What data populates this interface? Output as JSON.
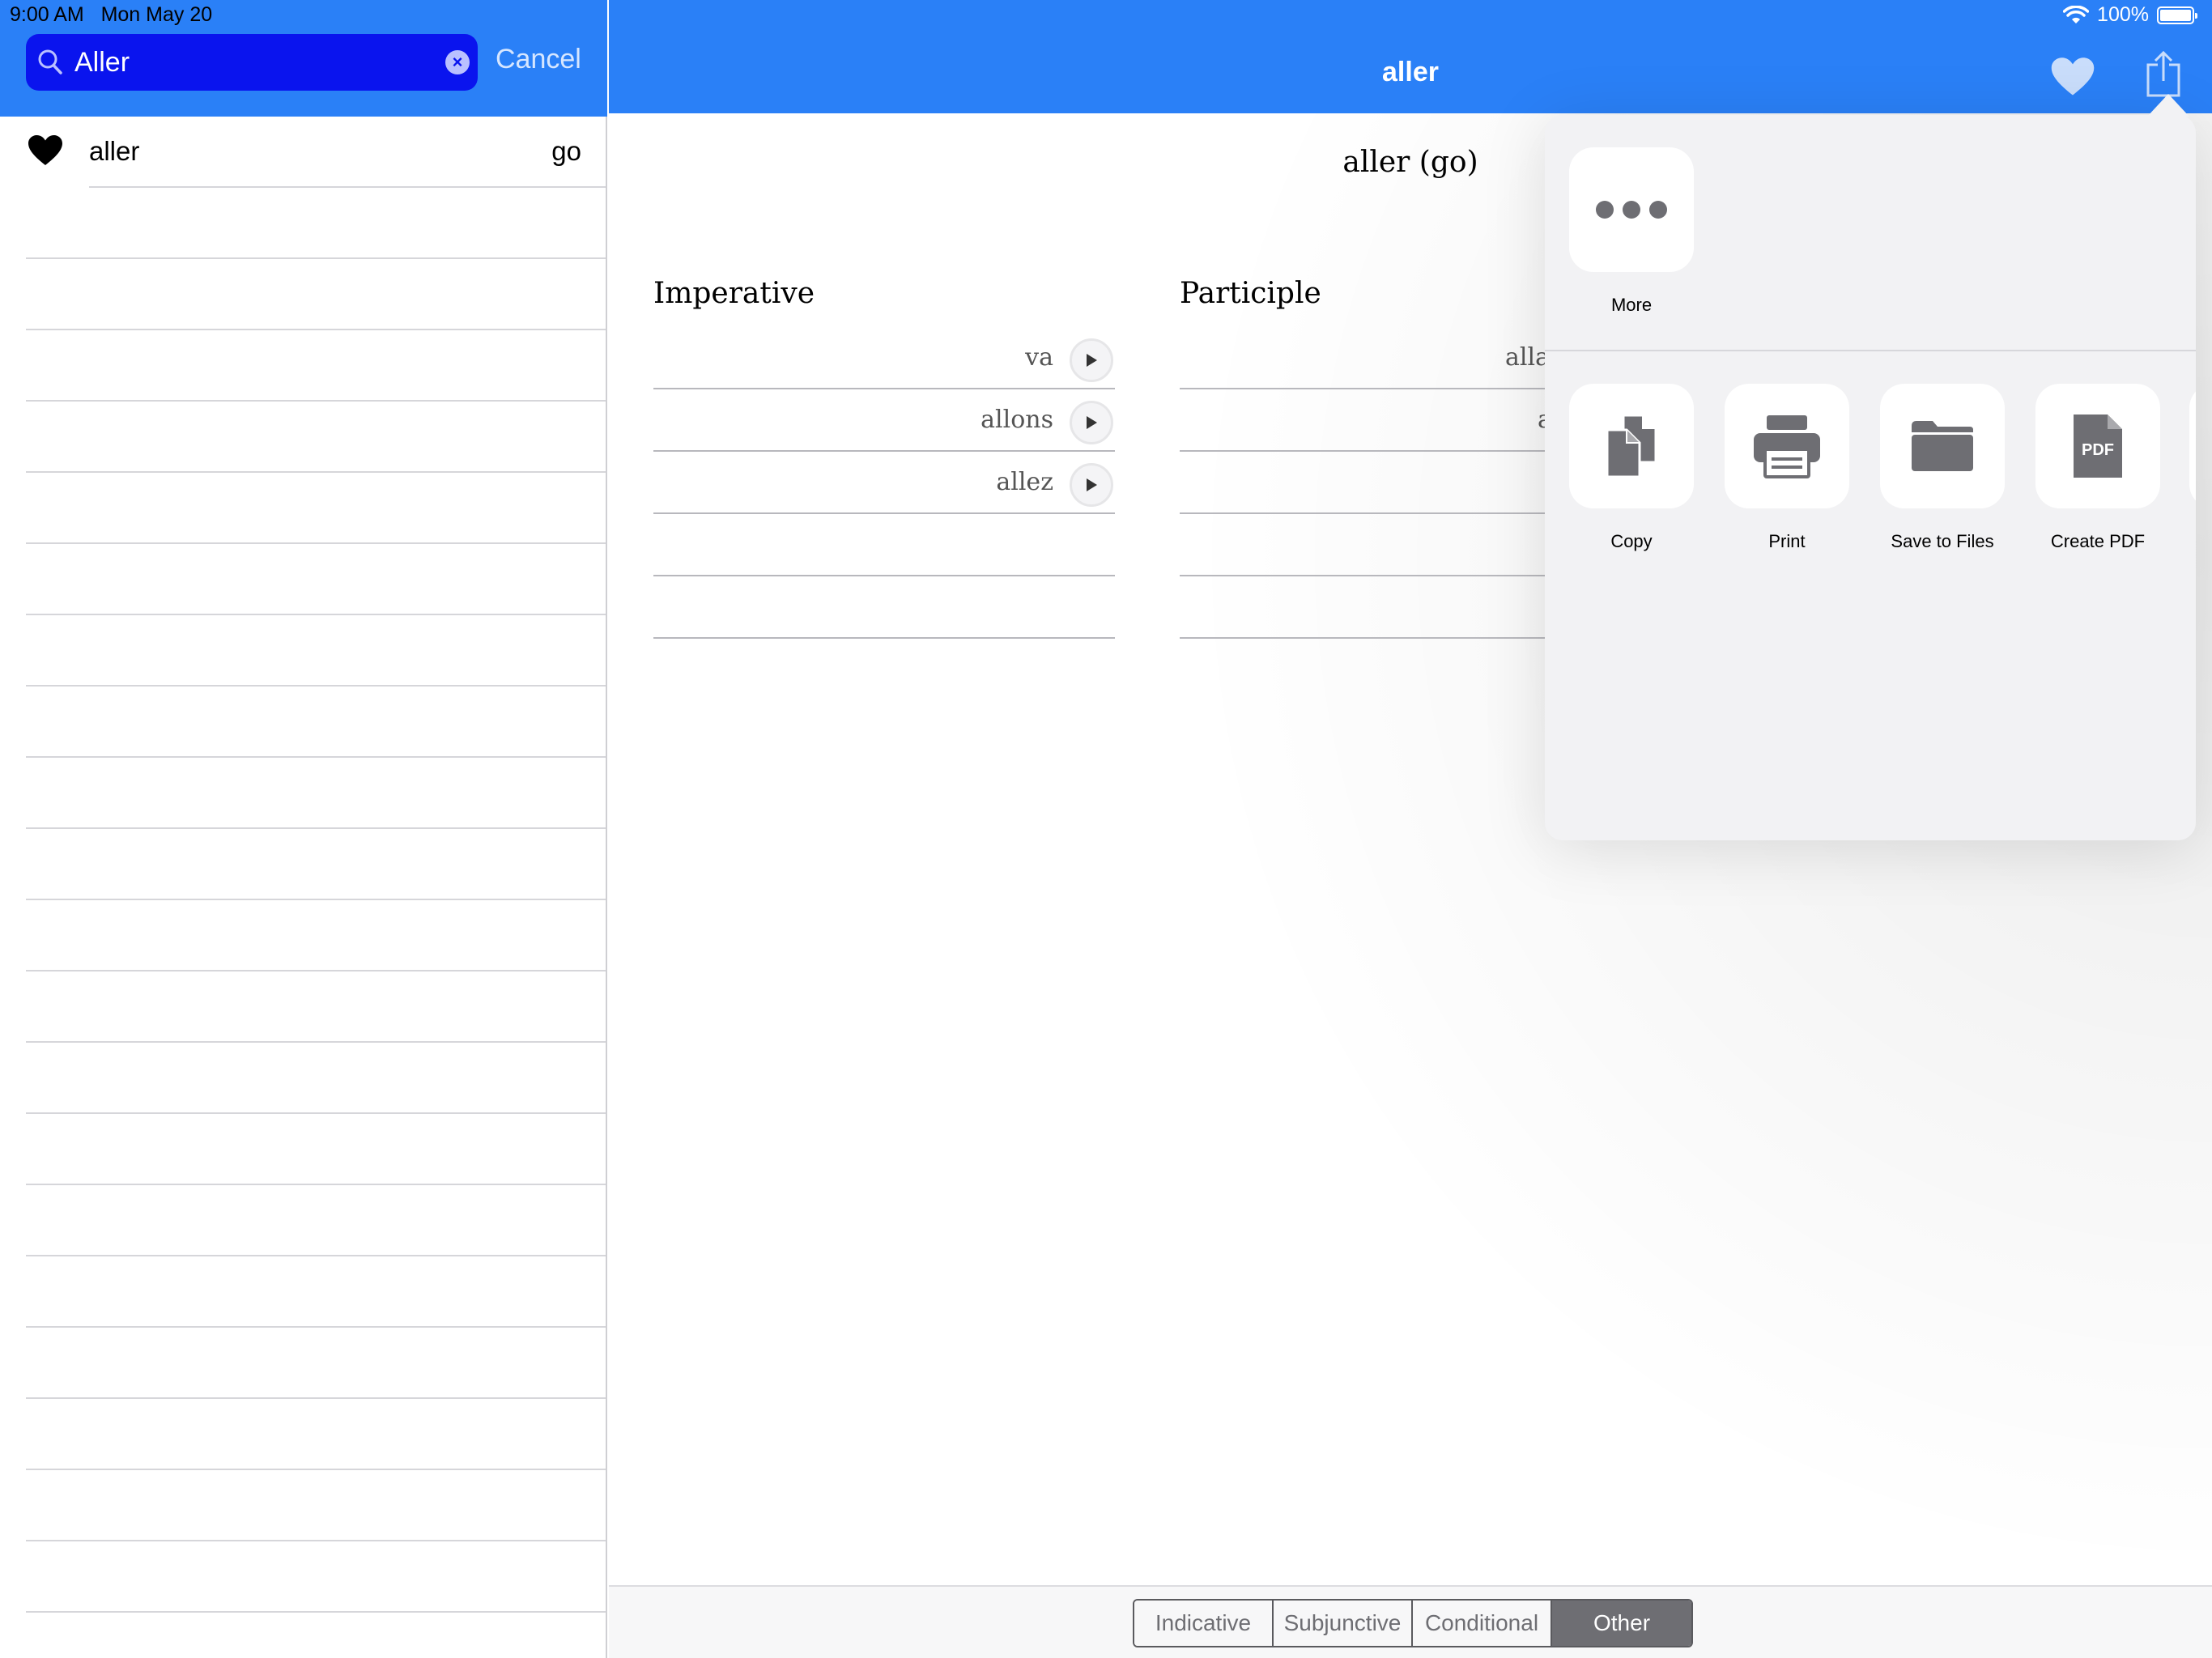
{
  "status_bar": {
    "time": "9:00 AM",
    "date": "Mon May 20",
    "battery_percent": "100%",
    "battery_level": 1.0
  },
  "search": {
    "value": "Aller",
    "placeholder": "Search",
    "cancel_label": "Cancel"
  },
  "results": [
    {
      "word": "aller",
      "translation": "go",
      "favorite": true
    }
  ],
  "main": {
    "title": "aller",
    "verb_heading": "aller (go)",
    "sections": [
      {
        "title": "Imperative",
        "forms": [
          "va",
          "allons",
          "allez"
        ],
        "empty_rows": 2
      },
      {
        "title": "Participle",
        "forms": [
          "alla",
          "a"
        ],
        "empty_rows": 3
      }
    ]
  },
  "tabs": [
    {
      "label": "Indicative",
      "active": false
    },
    {
      "label": "Subjunctive",
      "active": false
    },
    {
      "label": "Conditional",
      "active": false
    },
    {
      "label": "Other",
      "active": true
    }
  ],
  "share_sheet": {
    "top_actions": [
      {
        "label": "More",
        "icon": "more-icon"
      }
    ],
    "actions": [
      {
        "label": "Copy",
        "icon": "copy-icon"
      },
      {
        "label": "Print",
        "icon": "print-icon"
      },
      {
        "label": "Save to Files",
        "icon": "folder-icon"
      },
      {
        "label": "Create PDF",
        "icon": "pdf-icon",
        "icon_text": "PDF"
      }
    ]
  },
  "colors": {
    "header_blue": "#2a80f7",
    "search_field": "#0a14ee",
    "icon_gray": "#6e6e73"
  }
}
